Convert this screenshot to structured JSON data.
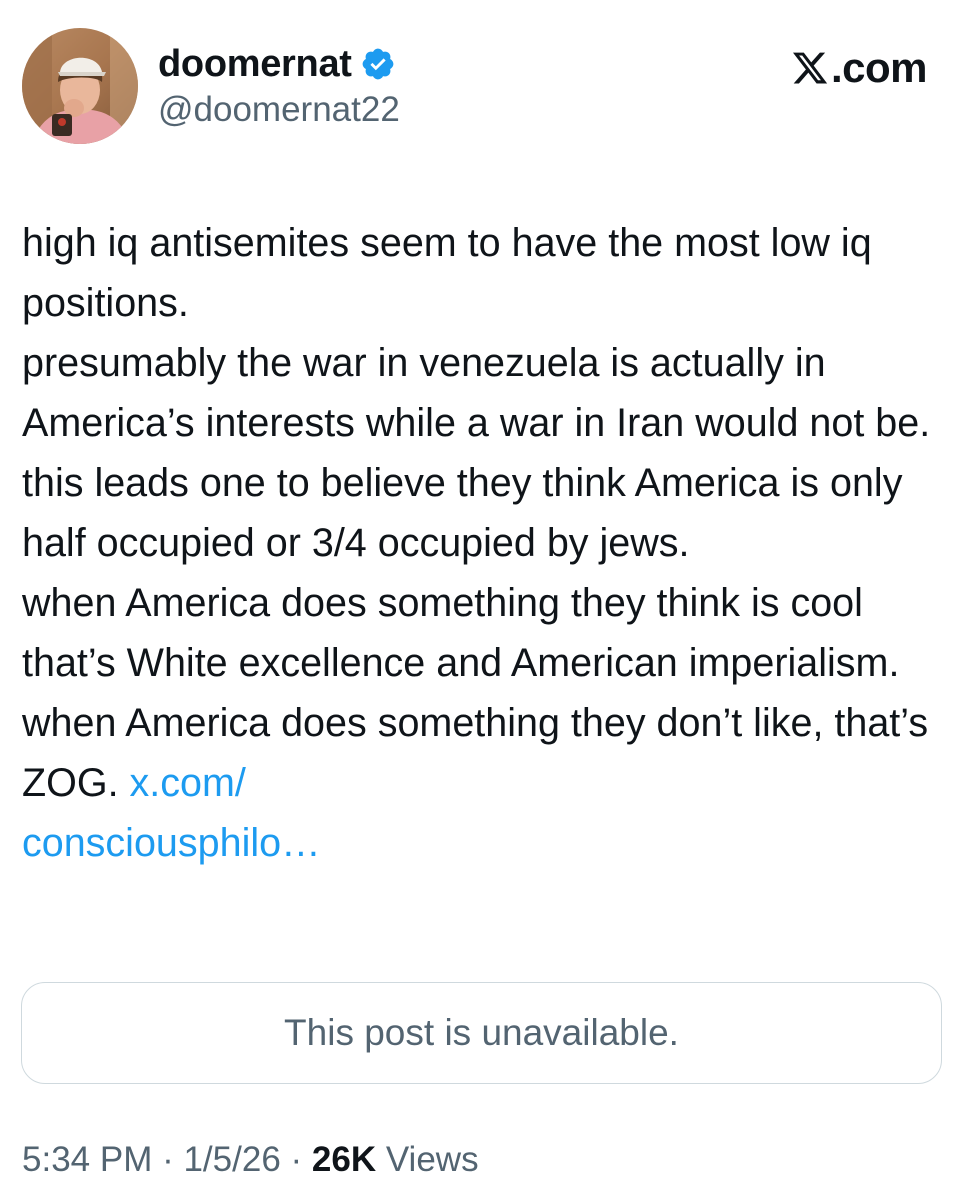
{
  "author": {
    "display_name": "doomernat",
    "handle": "@doomernat22",
    "verified": true
  },
  "brand": {
    "text": ".com"
  },
  "tweet": {
    "paragraphs": [
      "high iq antisemites seem to have the most low iq positions.",
      "presumably the war in venezuela is actually in America’s interests while a war in Iran would not be. this leads one to believe they think America is only half occupied or 3/4 occupied by jews."
    ],
    "last_paragraph_text": "when America does something they think is cool that’s White excellence and American imperialism. when America does something they don’t like, that’s ZOG. ",
    "link_line1": "x.com/",
    "link_line2": "consciousphilo…"
  },
  "quote": {
    "text": "This post is unavailable."
  },
  "meta": {
    "time": "5:34 PM",
    "separator1": " · ",
    "date": "1/5/26",
    "separator2": " · ",
    "views_count": "26K",
    "views_label": " Views"
  },
  "colors": {
    "text": "#0f1419",
    "secondary": "#536471",
    "link": "#1d9bf0",
    "verified": "#1d9bf0",
    "border": "#cfd9de"
  },
  "icons": {
    "verified": "verified-badge-icon",
    "brand": "x-logo-icon",
    "avatar": "profile-photo"
  }
}
